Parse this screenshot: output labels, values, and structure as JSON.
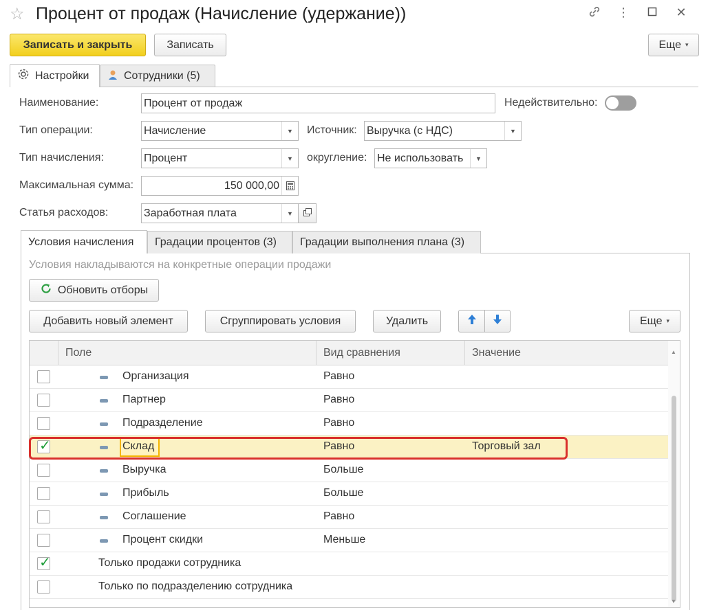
{
  "window": {
    "title": "Процент от продаж (Начисление (удержание))"
  },
  "toolbar": {
    "save_close_label": "Записать и закрыть",
    "save_label": "Записать",
    "more_label": "Еще"
  },
  "tabs": [
    {
      "label": "Настройки"
    },
    {
      "label": "Сотрудники (5)"
    }
  ],
  "form": {
    "name_label": "Наименование:",
    "name_value": "Процент от продаж",
    "invalid_label": "Недействительно:",
    "op_type_label": "Тип операции:",
    "op_type_value": "Начисление",
    "source_label": "Источник:",
    "source_value": "Выручка (с НДС)",
    "calc_type_label": "Тип начисления:",
    "calc_type_value": "Процент",
    "rounding_label": "округление:",
    "rounding_value": "Не использовать",
    "max_sum_label": "Максимальная сумма:",
    "max_sum_value": "150 000,00",
    "expense_label": "Статья расходов:",
    "expense_value": "Заработная плата"
  },
  "inner_tabs": [
    {
      "label": "Условия начисления"
    },
    {
      "label": "Градации процентов (3)"
    },
    {
      "label": "Градации выполнения плана (3)"
    }
  ],
  "conditions": {
    "hint": "Условия накладываются на конкретные операции продажи",
    "refresh_label": "Обновить отборы",
    "add_label": "Добавить новый элемент",
    "group_label": "Сгруппировать условия",
    "delete_label": "Удалить",
    "more_label": "Еще"
  },
  "table": {
    "columns": [
      "Поле",
      "Вид сравнения",
      "Значение"
    ],
    "rows": [
      {
        "checked": false,
        "field": "Организация",
        "comparison": "Равно",
        "value": "",
        "dash": true
      },
      {
        "checked": false,
        "field": "Партнер",
        "comparison": "Равно",
        "value": "",
        "dash": true
      },
      {
        "checked": false,
        "field": "Подразделение",
        "comparison": "Равно",
        "value": "",
        "dash": true
      },
      {
        "checked": true,
        "field": "Склад",
        "comparison": "Равно",
        "value": "Торговый зал",
        "dash": true,
        "selected": true
      },
      {
        "checked": false,
        "field": "Выручка",
        "comparison": "Больше",
        "value": "",
        "dash": true
      },
      {
        "checked": false,
        "field": "Прибыль",
        "comparison": "Больше",
        "value": "",
        "dash": true
      },
      {
        "checked": false,
        "field": "Соглашение",
        "comparison": "Равно",
        "value": "",
        "dash": true
      },
      {
        "checked": false,
        "field": "Процент скидки",
        "comparison": "Меньше",
        "value": "",
        "dash": true
      },
      {
        "checked": true,
        "field": "Только продажи сотрудника",
        "comparison": "",
        "value": "",
        "dash": false
      },
      {
        "checked": false,
        "field": "Только по подразделению сотрудника",
        "comparison": "",
        "value": "",
        "dash": false
      }
    ]
  },
  "colors": {
    "primary_button": "#f2cf1d",
    "selected_row": "#fbf2c4",
    "highlight_border": "#d9302c",
    "check": "#1f9d3a"
  }
}
